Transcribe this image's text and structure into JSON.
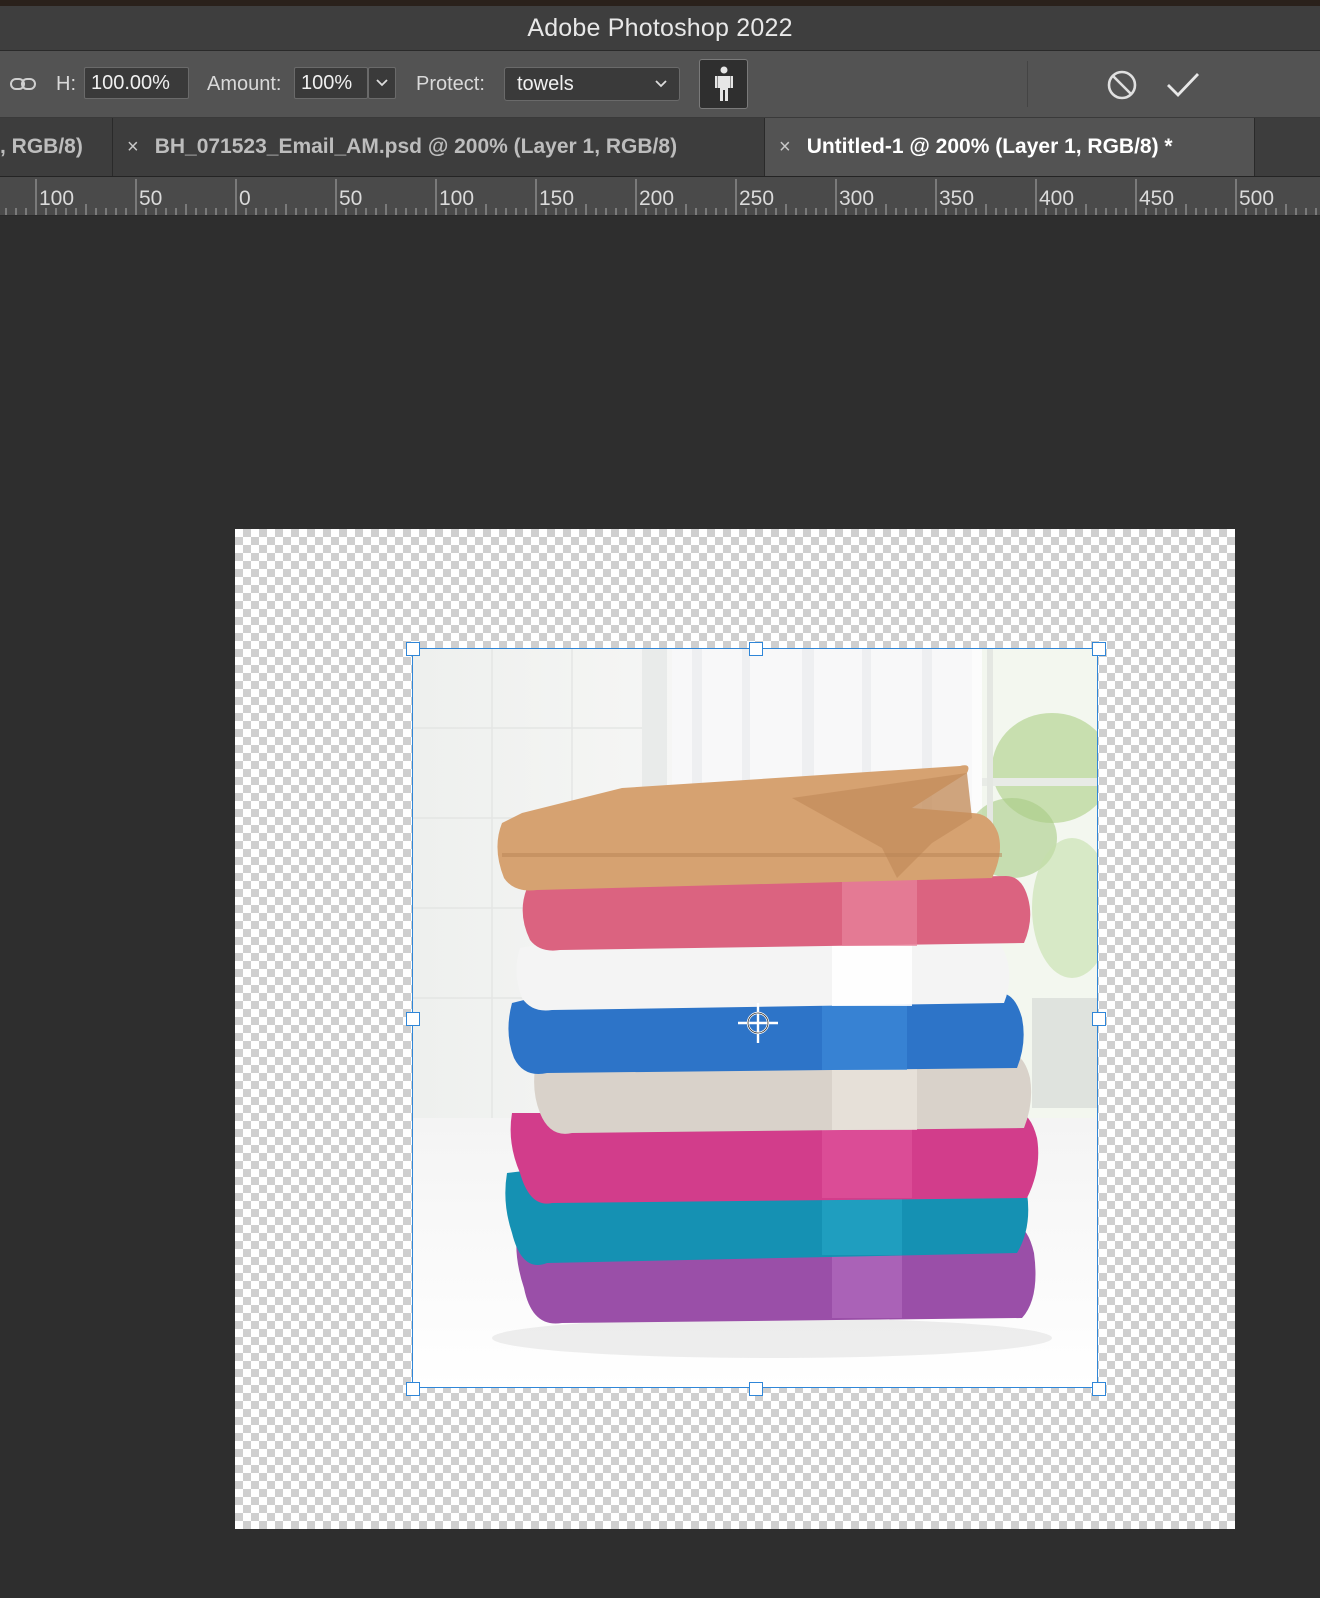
{
  "window": {
    "title": "Adobe Photoshop 2022"
  },
  "options": {
    "link_icon": "link-icon",
    "height_label": "H:",
    "height_value": "100.00%",
    "amount_label": "Amount:",
    "amount_value": "100%",
    "protect_label": "Protect:",
    "protect_value": "towels",
    "protect_skin_icon": "person-icon",
    "cancel_icon": "cancel-icon",
    "commit_icon": "checkmark-icon"
  },
  "tabs": [
    {
      "label": ", RGB/8)",
      "active": false
    },
    {
      "label": "BH_071523_Email_AM.psd @ 200% (Layer 1, RGB/8)",
      "active": false
    },
    {
      "label": "Untitled-1 @ 200% (Layer 1, RGB/8) *",
      "active": true
    }
  ],
  "tab_close": "×",
  "ruler": {
    "labels": [
      "100",
      "50",
      "0",
      "50",
      "100",
      "150",
      "200",
      "250",
      "300",
      "350",
      "400",
      "450",
      "500"
    ]
  },
  "colors": {
    "selection": "#2f86d8",
    "towels": [
      "#d6a271",
      "#db6380",
      "#f2f2f2",
      "#2d74c8",
      "#d9d2ca",
      "#d23d8b",
      "#1591b3",
      "#9a4fa8"
    ]
  }
}
